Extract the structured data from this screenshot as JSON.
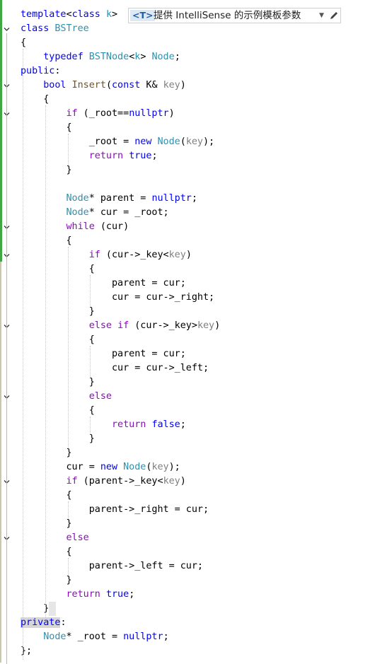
{
  "editor": {
    "template_hint": {
      "badge": "<T>",
      "text": "提供 IntelliSense 的示例模板参数"
    },
    "lines": [
      [
        {
          "t": "template",
          "c": "kw"
        },
        {
          "t": "<",
          "c": "plain"
        },
        {
          "t": "class",
          "c": "kw"
        },
        {
          "t": " ",
          "c": "plain"
        },
        {
          "t": "k",
          "c": "type"
        },
        {
          "t": ">",
          "c": "plain"
        }
      ],
      [
        {
          "t": "class",
          "c": "kw"
        },
        {
          "t": " ",
          "c": "plain"
        },
        {
          "t": "BSTree",
          "c": "type"
        }
      ],
      [
        {
          "t": "{",
          "c": "plain"
        }
      ],
      [
        {
          "t": "    ",
          "c": "plain"
        },
        {
          "t": "typedef",
          "c": "kw"
        },
        {
          "t": " ",
          "c": "plain"
        },
        {
          "t": "BSTNode",
          "c": "type"
        },
        {
          "t": "<",
          "c": "plain"
        },
        {
          "t": "k",
          "c": "type"
        },
        {
          "t": "> ",
          "c": "plain"
        },
        {
          "t": "Node",
          "c": "type"
        },
        {
          "t": ";",
          "c": "plain"
        }
      ],
      [
        {
          "t": "public",
          "c": "kw"
        },
        {
          "t": ":",
          "c": "plain"
        }
      ],
      [
        {
          "t": "    ",
          "c": "plain"
        },
        {
          "t": "bool",
          "c": "kw"
        },
        {
          "t": " ",
          "c": "plain"
        },
        {
          "t": "Insert",
          "c": "fn"
        },
        {
          "t": "(",
          "c": "plain"
        },
        {
          "t": "const",
          "c": "kw"
        },
        {
          "t": " ",
          "c": "plain"
        },
        {
          "t": "K",
          "c": "plain"
        },
        {
          "t": "& ",
          "c": "plain"
        },
        {
          "t": "key",
          "c": "param"
        },
        {
          "t": ")",
          "c": "plain"
        }
      ],
      [
        {
          "t": "    {",
          "c": "plain"
        }
      ],
      [
        {
          "t": "        ",
          "c": "plain"
        },
        {
          "t": "if",
          "c": "ctl"
        },
        {
          "t": " (_root==",
          "c": "plain"
        },
        {
          "t": "nullptr",
          "c": "kw"
        },
        {
          "t": ")",
          "c": "plain"
        }
      ],
      [
        {
          "t": "        {",
          "c": "plain"
        }
      ],
      [
        {
          "t": "            _root = ",
          "c": "plain"
        },
        {
          "t": "new",
          "c": "kw"
        },
        {
          "t": " ",
          "c": "plain"
        },
        {
          "t": "Node",
          "c": "type"
        },
        {
          "t": "(",
          "c": "plain"
        },
        {
          "t": "key",
          "c": "param"
        },
        {
          "t": ");",
          "c": "plain"
        }
      ],
      [
        {
          "t": "            ",
          "c": "plain"
        },
        {
          "t": "return",
          "c": "ctl"
        },
        {
          "t": " ",
          "c": "plain"
        },
        {
          "t": "true",
          "c": "kw"
        },
        {
          "t": ";",
          "c": "plain"
        }
      ],
      [
        {
          "t": "        }",
          "c": "plain"
        }
      ],
      [],
      [
        {
          "t": "        ",
          "c": "plain"
        },
        {
          "t": "Node",
          "c": "type"
        },
        {
          "t": "* parent = ",
          "c": "plain"
        },
        {
          "t": "nullptr",
          "c": "kw"
        },
        {
          "t": ";",
          "c": "plain"
        }
      ],
      [
        {
          "t": "        ",
          "c": "plain"
        },
        {
          "t": "Node",
          "c": "type"
        },
        {
          "t": "* cur = _root;",
          "c": "plain"
        }
      ],
      [
        {
          "t": "        ",
          "c": "plain"
        },
        {
          "t": "while",
          "c": "ctl"
        },
        {
          "t": " (cur)",
          "c": "plain"
        }
      ],
      [
        {
          "t": "        {",
          "c": "plain"
        }
      ],
      [
        {
          "t": "            ",
          "c": "plain"
        },
        {
          "t": "if",
          "c": "ctl"
        },
        {
          "t": " (cur->_key<",
          "c": "plain"
        },
        {
          "t": "key",
          "c": "param"
        },
        {
          "t": ")",
          "c": "plain"
        }
      ],
      [
        {
          "t": "            {",
          "c": "plain"
        }
      ],
      [
        {
          "t": "                parent = cur;",
          "c": "plain"
        }
      ],
      [
        {
          "t": "                cur = cur->_right;",
          "c": "plain"
        }
      ],
      [
        {
          "t": "            }",
          "c": "plain"
        }
      ],
      [
        {
          "t": "            ",
          "c": "plain"
        },
        {
          "t": "else",
          "c": "ctl"
        },
        {
          "t": " ",
          "c": "plain"
        },
        {
          "t": "if",
          "c": "ctl"
        },
        {
          "t": " (cur->_key>",
          "c": "plain"
        },
        {
          "t": "key",
          "c": "param"
        },
        {
          "t": ")",
          "c": "plain"
        }
      ],
      [
        {
          "t": "            {",
          "c": "plain"
        }
      ],
      [
        {
          "t": "                parent = cur;",
          "c": "plain"
        }
      ],
      [
        {
          "t": "                cur = cur->_left;",
          "c": "plain"
        }
      ],
      [
        {
          "t": "            }",
          "c": "plain"
        }
      ],
      [
        {
          "t": "            ",
          "c": "plain"
        },
        {
          "t": "else",
          "c": "ctl"
        }
      ],
      [
        {
          "t": "            {",
          "c": "plain"
        }
      ],
      [
        {
          "t": "                ",
          "c": "plain"
        },
        {
          "t": "return",
          "c": "ctl"
        },
        {
          "t": " ",
          "c": "plain"
        },
        {
          "t": "false",
          "c": "kw"
        },
        {
          "t": ";",
          "c": "plain"
        }
      ],
      [
        {
          "t": "            }",
          "c": "plain"
        }
      ],
      [
        {
          "t": "        }",
          "c": "plain"
        }
      ],
      [
        {
          "t": "        cur = ",
          "c": "plain"
        },
        {
          "t": "new",
          "c": "kw"
        },
        {
          "t": " ",
          "c": "plain"
        },
        {
          "t": "Node",
          "c": "type"
        },
        {
          "t": "(",
          "c": "plain"
        },
        {
          "t": "key",
          "c": "param"
        },
        {
          "t": ");",
          "c": "plain"
        }
      ],
      [
        {
          "t": "        ",
          "c": "plain"
        },
        {
          "t": "if",
          "c": "ctl"
        },
        {
          "t": " (parent->_key<",
          "c": "plain"
        },
        {
          "t": "key",
          "c": "param"
        },
        {
          "t": ")",
          "c": "plain"
        }
      ],
      [
        {
          "t": "        {",
          "c": "plain"
        }
      ],
      [
        {
          "t": "            parent->_right = cur;",
          "c": "plain"
        }
      ],
      [
        {
          "t": "        }",
          "c": "plain"
        }
      ],
      [
        {
          "t": "        ",
          "c": "plain"
        },
        {
          "t": "else",
          "c": "ctl"
        }
      ],
      [
        {
          "t": "        {",
          "c": "plain"
        }
      ],
      [
        {
          "t": "            parent->_left = cur;",
          "c": "plain"
        }
      ],
      [
        {
          "t": "        }",
          "c": "plain"
        }
      ],
      [
        {
          "t": "        ",
          "c": "plain"
        },
        {
          "t": "return",
          "c": "ctl"
        },
        {
          "t": " ",
          "c": "plain"
        },
        {
          "t": "true",
          "c": "kw"
        },
        {
          "t": ";",
          "c": "plain"
        }
      ],
      [
        {
          "t": "    }",
          "c": "plain"
        }
      ],
      [
        {
          "t": "private",
          "c": "kw"
        },
        {
          "t": ":",
          "c": "plain"
        }
      ],
      [
        {
          "t": "    ",
          "c": "plain"
        },
        {
          "t": "Node",
          "c": "type"
        },
        {
          "t": "* _root = ",
          "c": "plain"
        },
        {
          "t": "nullptr",
          "c": "kw"
        },
        {
          "t": ";",
          "c": "plain"
        }
      ],
      [
        {
          "t": "};",
          "c": "plain"
        }
      ]
    ],
    "fold_markers": [
      1,
      5,
      7,
      15,
      17,
      22,
      27,
      33,
      37
    ],
    "colors": {
      "keyword": "#0000ff",
      "control": "#8f08c4",
      "type": "#2b91af",
      "function": "#74531f",
      "parameter": "#808080",
      "change_bar": "#3fa845"
    }
  }
}
